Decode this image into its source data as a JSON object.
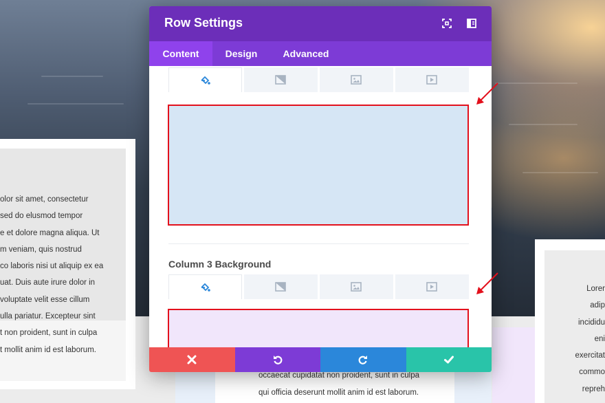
{
  "modal": {
    "title": "Row Settings",
    "tabs": [
      {
        "label": "Content",
        "active": true
      },
      {
        "label": "Design",
        "active": false
      },
      {
        "label": "Advanced",
        "active": false
      }
    ],
    "background_tabs": [
      "color",
      "gradient",
      "image",
      "video"
    ],
    "column2_background_color": "#d6e6f5",
    "column3_label": "Column 3 Background",
    "column3_background_color": "#f1e6fb",
    "highlight_color": "#e3101c",
    "footer_buttons": [
      {
        "name": "discard",
        "icon": "close-icon",
        "color": "#ef5454"
      },
      {
        "name": "undo",
        "icon": "undo-icon",
        "color": "#7d3bd6"
      },
      {
        "name": "redo",
        "icon": "redo-icon",
        "color": "#2b87da"
      },
      {
        "name": "save",
        "icon": "check-icon",
        "color": "#29c4a9"
      }
    ],
    "header_icons": [
      "fullscreen-icon",
      "split-view-icon"
    ],
    "header_color": "#6c2eb9",
    "tab_bar_color": "#7d3bd6"
  },
  "left_card": {
    "lines": [
      "olor sit amet, consectetur",
      "sed do elusmod tempor",
      "e et dolore magna aliqua. Ut",
      "m veniam, quis nostrud",
      "co laboris nisi ut aliquip ex ea",
      "uat. Duis aute irure dolor in",
      "voluptate velit esse cillum",
      "ulla pariatur. Excepteur sint",
      "t non proident, sunt in culpa",
      "t mollit anim id est laborum."
    ]
  },
  "bottom_card": {
    "lines": [
      "occaecat cupidatat non proident, sunt in culpa",
      "qui officia deserunt mollit anim id est laborum."
    ]
  },
  "right_card": {
    "lines": [
      "Lorer",
      "adip",
      "incididu",
      "eni",
      "exercitat",
      "commo",
      "repreh"
    ]
  }
}
